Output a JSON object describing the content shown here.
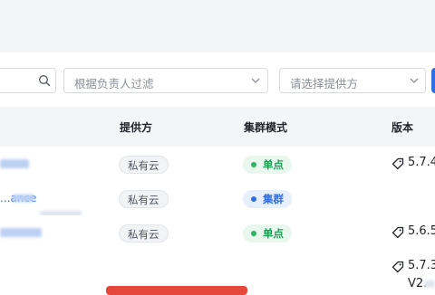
{
  "filters": {
    "owner_placeholder": "根据负责人过滤",
    "provider_placeholder": "请选择提供方"
  },
  "table": {
    "columns": {
      "provider": "提供方",
      "cluster_mode": "集群模式",
      "version": "版本"
    },
    "rows": [
      {
        "name_fragment": "",
        "provider": "私有云",
        "mode": "单点",
        "mode_color": "#2fb463",
        "version": "5.7.4"
      },
      {
        "name_fragment": "...ance",
        "provider": "私有云",
        "mode": "集群",
        "mode_color": "#2f6fe4",
        "version": ""
      },
      {
        "name_fragment": "",
        "provider": "私有云",
        "mode": "单点",
        "mode_color": "#2fb463",
        "version": "5.6.5"
      },
      {
        "name_fragment": "",
        "provider": "",
        "mode": "",
        "mode_color": "",
        "version": "5.7.3",
        "version_alt": "V2."
      }
    ]
  },
  "colors": {
    "primary": "#2f6fe4",
    "danger": "#e5483b"
  }
}
